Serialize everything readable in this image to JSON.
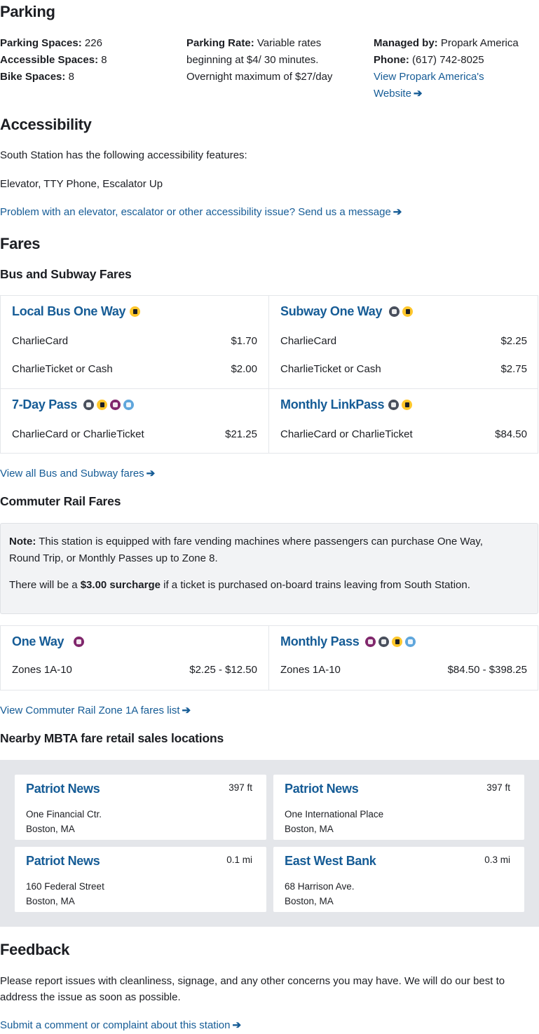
{
  "parking": {
    "heading": "Parking",
    "spaces_label": "Parking Spaces:",
    "spaces_value": "226",
    "accessible_label": "Accessible Spaces:",
    "accessible_value": "8",
    "bike_label": "Bike Spaces:",
    "bike_value": "8",
    "rate_label": "Parking Rate:",
    "rate_line1": "Variable rates",
    "rate_line2": "beginning at $4/ 30 minutes.",
    "rate_line3": "Overnight maximum of $27/day",
    "managed_label": "Managed by:",
    "managed_value": "Propark America",
    "phone_label": "Phone:",
    "phone_value": "(617) 742-8025",
    "website_line1": "View Propark America's",
    "website_line2": "Website"
  },
  "accessibility": {
    "heading": "Accessibility",
    "intro": "South Station has the following accessibility features:",
    "features": "Elevator, TTY Phone, Escalator Up",
    "problem_link": "Problem with an elevator, escalator or other accessibility issue? Send us a message"
  },
  "fares": {
    "heading": "Fares",
    "bus_subway_heading": "Bus and Subway Fares",
    "cards": [
      {
        "title": "Local Bus One Way",
        "icons": [
          "bus-icon"
        ],
        "rows": [
          {
            "label": "CharlieCard",
            "price": "$1.70"
          },
          {
            "label": "CharlieTicket or Cash",
            "price": "$2.00"
          }
        ]
      },
      {
        "title": "Subway One Way",
        "icons": [
          "subway-icon",
          "bus-icon"
        ],
        "rows": [
          {
            "label": "CharlieCard",
            "price": "$2.25"
          },
          {
            "label": "CharlieTicket or Cash",
            "price": "$2.75"
          }
        ]
      },
      {
        "title": "7-Day Pass",
        "icons": [
          "subway-icon",
          "bus-icon",
          "commuter-rail-icon",
          "ferry-icon"
        ],
        "rows": [
          {
            "label": "CharlieCard or CharlieTicket",
            "price": "$21.25"
          }
        ]
      },
      {
        "title": "Monthly LinkPass",
        "icons": [
          "subway-icon",
          "bus-icon"
        ],
        "rows": [
          {
            "label": "CharlieCard or CharlieTicket",
            "price": "$84.50"
          }
        ]
      }
    ],
    "view_bus_subway_link": "View all Bus and Subway fares",
    "commuter_rail_heading": "Commuter Rail Fares",
    "note_label": "Note:",
    "note_text": "This station is equipped with fare vending machines where passengers can purchase One Way,",
    "note_text2": "Round Trip, or Monthly Passes up to Zone 8.",
    "surcharge_pre": "There will be a",
    "surcharge_bold": "$3.00 surcharge",
    "surcharge_post": "if a ticket is purchased on-board trains leaving from South Station.",
    "cr_cards": [
      {
        "title": "One Way",
        "icons": [
          "commuter-rail-icon"
        ],
        "rows": [
          {
            "label": "Zones 1A-10",
            "price": "$2.25 - $12.50"
          }
        ]
      },
      {
        "title": "Monthly Pass",
        "icons": [
          "commuter-rail-icon",
          "subway-icon",
          "bus-icon",
          "ferry-icon"
        ],
        "rows": [
          {
            "label": "Zones 1A-10",
            "price": "$84.50 - $398.25"
          }
        ]
      }
    ],
    "view_cr_link": "View Commuter Rail Zone 1A fares list"
  },
  "retail": {
    "heading": "Nearby MBTA fare retail sales locations",
    "locations": [
      {
        "name": "Patriot News",
        "distance": "397 ft",
        "addr1": "One Financial Ctr.",
        "addr2": "Boston, MA"
      },
      {
        "name": "Patriot News",
        "distance": "397 ft",
        "addr1": "One International Place",
        "addr2": "Boston, MA"
      },
      {
        "name": "Patriot News",
        "distance": "0.1 mi",
        "addr1": "160 Federal Street",
        "addr2": "Boston, MA"
      },
      {
        "name": "East West Bank",
        "distance": "0.3 mi",
        "addr1": "68 Harrison Ave.",
        "addr2": "Boston, MA"
      }
    ]
  },
  "feedback": {
    "heading": "Feedback",
    "text_line1": "Please report issues with cleanliness, signage, and any other concerns you may have. We will do our best to",
    "text_line2": "address the issue as soon as possible.",
    "submit_link": "Submit a comment or complaint about this station"
  },
  "colors": {
    "link": "#165c96",
    "bus": "#ffc72c",
    "subway": "#494f5c",
    "commuter_rail": "#80276c",
    "ferry": "#5fa6dc"
  }
}
